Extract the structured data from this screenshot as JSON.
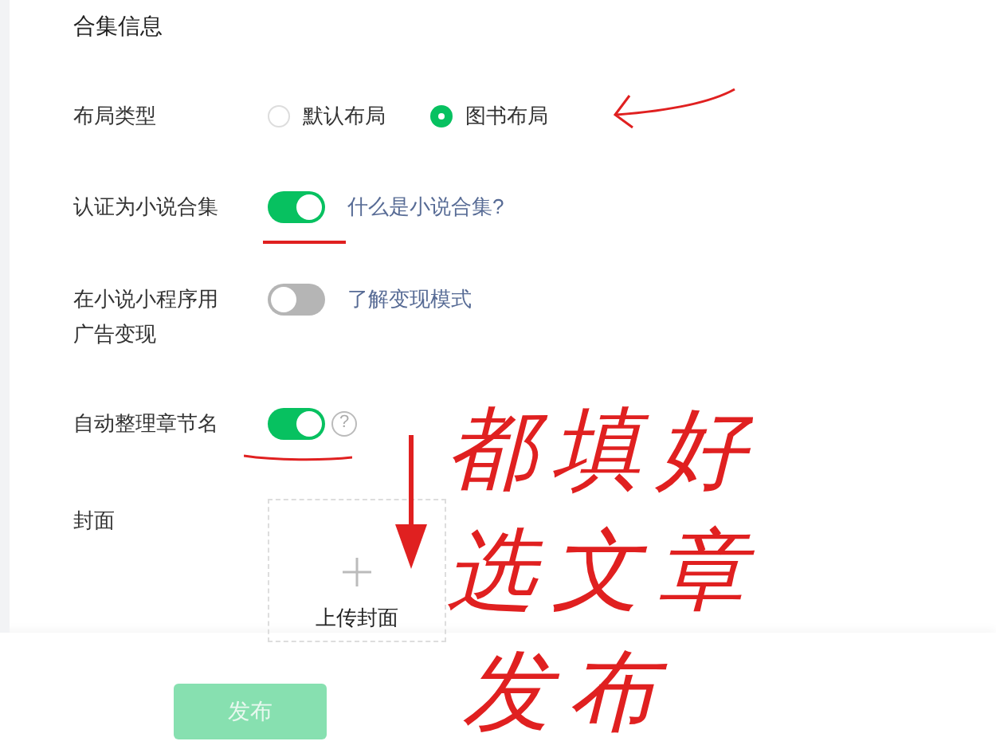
{
  "section_title": "合集信息",
  "layout_type": {
    "label": "布局类型",
    "options": [
      {
        "label": "默认布局",
        "selected": false
      },
      {
        "label": "图书布局",
        "selected": true
      }
    ]
  },
  "settings": [
    {
      "label": "认证为小说合集",
      "on": true,
      "link": "什么是小说合集?",
      "kind": "link"
    },
    {
      "label": "在小说小程序用广告变现",
      "on": false,
      "link": "了解变现模式",
      "kind": "link"
    },
    {
      "label": "自动整理章节名",
      "on": true,
      "kind": "help",
      "help_icon": "?"
    }
  ],
  "cover": {
    "label": "封面",
    "upload": "上传封面"
  },
  "publish_button": {
    "label": "发布",
    "disabled": true
  },
  "annotations": {
    "lines": [
      "都填好",
      "选文章",
      "发布"
    ]
  }
}
